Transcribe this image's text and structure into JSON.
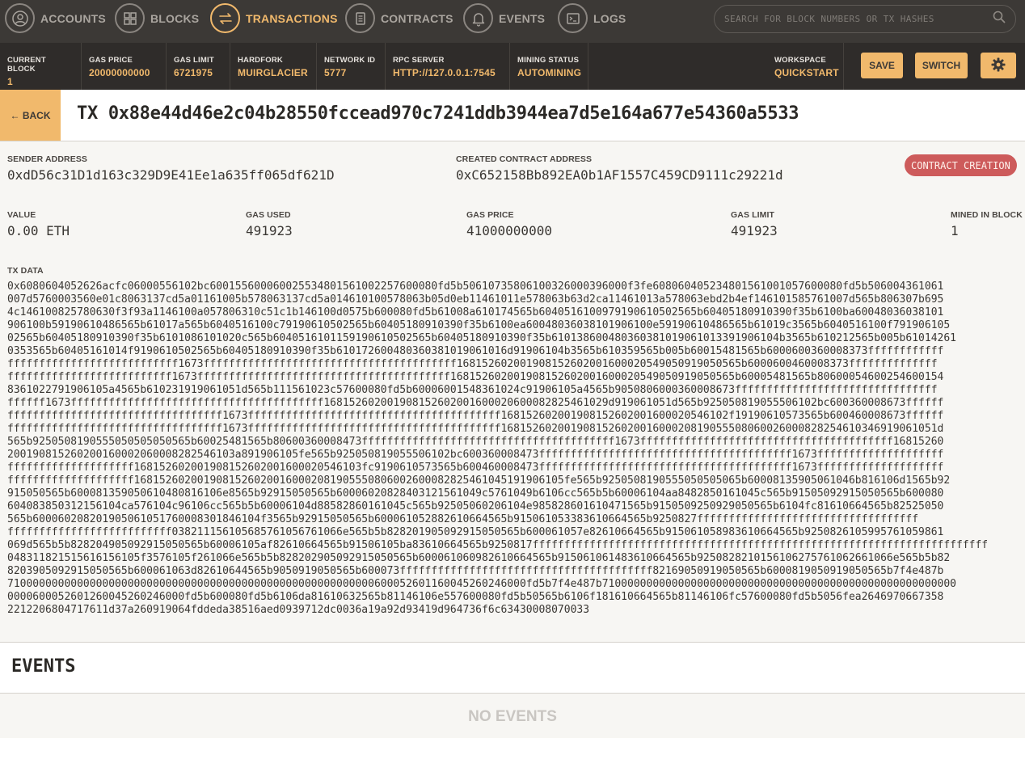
{
  "nav": {
    "items": [
      {
        "label": "Accounts",
        "icon": "person-icon"
      },
      {
        "label": "Blocks",
        "icon": "grid-icon"
      },
      {
        "label": "Transactions",
        "icon": "swap-arrows-icon"
      },
      {
        "label": "Contracts",
        "icon": "document-icon"
      },
      {
        "label": "Events",
        "icon": "bell-icon"
      },
      {
        "label": "Logs",
        "icon": "terminal-icon"
      }
    ],
    "active": "Transactions",
    "search_placeholder": "SEARCH FOR BLOCK NUMBERS OR TX HASHES"
  },
  "status": {
    "current_block": {
      "label": "Current Block",
      "value": "1"
    },
    "gas_price": {
      "label": "Gas Price",
      "value": "20000000000"
    },
    "gas_limit": {
      "label": "Gas Limit",
      "value": "6721975"
    },
    "hardfork": {
      "label": "Hardfork",
      "value": "Muirglacier"
    },
    "network_id": {
      "label": "Network ID",
      "value": "5777"
    },
    "rpc_server": {
      "label": "RPC Server",
      "value": "HTTP://127.0.0.1:7545"
    },
    "mining_status": {
      "label": "Mining Status",
      "value": "Automining"
    },
    "workspace": {
      "label": "Workspace",
      "value": "Quickstart"
    },
    "save_label": "Save",
    "switch_label": "Switch"
  },
  "tx": {
    "back_label": "← Back",
    "title": "TX 0x88e44d46e2c04b28550fccead970c7241ddb3944ea7d5e164a677e54360a5533",
    "sender_label": "Sender Address",
    "sender": "0xdD56c31D1d163c329D9E41Ee1a635ff065df621D",
    "contract_label": "Created Contract Address",
    "contract": "0xC652158Bb892EA0b1AF1557C459CD9111c29221d",
    "badge": "CONTRACT CREATION",
    "value_label": "Value",
    "value": "0.00 ETH",
    "gas_used_label": "Gas Used",
    "gas_used": "491923",
    "gas_price_label": "Gas Price",
    "gas_price": "41000000000",
    "gas_limit_label": "Gas Limit",
    "gas_limit": "491923",
    "mined_label": "Mined In Block",
    "mined": "1",
    "data_label": "TX Data",
    "data_lines": [
      "0x6080604052626acfc06000556102bc600155600060025534801561002257600080fd5b5061073580610032600039600 0f3fe6080604052348015610010576000 80fd5b506004361061",
      "007d5760003560e01c8063137cd5a01161005b578063137cd5a014610100578063b05d0eb11461011e578063b63d2ca11461013a578063ebd2b4ef146101585761007d565b806307b695",
      "4c146100825780630f3f93a1146100a057806310c51c1b146100d0575b600080fd5b61008a610174565b60405161009791906105025 65b60405180910390f35b6100ba60048036038101",
      "906100b59190610486565b61017a565b6040516100c79190610502565b60405180910390f35b6100ea6004803603810190610 0e59190610486565b61019c3565b6040516100f791906105",
      "02565b60405180910390f35b61010861010 20c565b6040516101159190610502565b60405180910390f35b6101386004803603810 19061013391906104b3565b610212565b005b61014261",
      "0353565b60405161014f9190610502565b60405180910390f35b61017260048036038101906101 6d91906104b3565b610359565b005b60015481565b6000600360008373ffffffffffff",
      "fffffffffffffffffffffffffff1673ffffffffffffffffffffffffffffffffffffffff168152602001908152602001600020549050919050565b60006004600083 73ffffffffffffff",
      "ffffffffffffffffffffffffff1673ffffffffffffffffffffffffffffffffffffffff16815260200190815260200160002054905091905056 5b60005481565b806000546002546001 54",
      "8361022791906105a4565b610231919061051d565b111561023c57600080fd5b60006001548361024c919061 05a4565b9050806000360008673ffffffffffffffffffffffffffffffff",
      "ffffff1673ffffffffffffffffffffffffffffffffffffffff16815260200190815260200160002060008282546 1029d919061051d565b925050819055506102bc600360008673ffffff",
      "ffffffffffffffffffffffffffffffffff1673ffffffffffffffffffffffffffffffffffffffff16815260200190815260200160002054 6102f19190610573565b600460008673ffffff",
      "ffffffffffffffffffffffffffffffffff1673ffffffffffffffffffffffffffffffffffffffff168152602001908152602001600020819055508060026000828254 61034691906 1051d",
      "565b92505081905550505050505 65b60025481565b80600360008473ffffffffffffffffffffffffffffffffffffffff1673ffffffffffffffffffffffffffffffffffffffff16815260",
      "2001908152602001600020600082825461 03a891906105fe565b925050819055506102bc600360008473ffffffffffffffffffffffffffffffffffffffff1673ffffffffffffffffffff",
      "ffffffffffffffffffff1681526020019081526020016000205461 03fc9190610573565b600460008473ffffffffffffffffffffffffffffffffffffffff1673ffffffffffffffffffff",
      "ffffffffffffffffffff1681526020019081526020016000208190555080600260008282546104519190610 5fe565b9250508190555050505065b60008135905061046b816106d1565b92",
      "915050565b6000813590506104808161 06e8565b92915050565b6000602082840312156104 9c5761049b6106cc565b5b6000610 4aa848285016104 5c565b91505092915050565b600080",
      "6040838503121561 04ca576104c96106cc565b5b60006104d88582860161045c565b92505060206104e985828601610471565b9150509250929050 565b6104fc81610664565b82525050",
      "565b600060208201905061 0517600083018461 04f3565b92915050565b60006105288261066456 5b9150610533836106645 65b9250827fffffffffffffffffffffffffffffffffff",
      "ffffffffffffffffffffffffff0382111561 0568576105676106 6e565b5b828201905092915050565b60006105 7e82610664565b91506105898361066 4565b9250826105995761059861",
      "069d565b5b828204905092915050565b60006105af82610664565b915061 05ba83610664565b9250817 ffffffffffffffffffffffffffffffffffffffffffffffffffffffffffffffffffffffff",
      "04831182151561 6156105f3576105f261066e565b5b828202905092915050565b60006106098261066456 5b915061 0614836106645 65b9250828210156106 27576106 2661066e565b5b82",
      "820390509291505056 5b60006106 3d82610644565b9050919050565b600073ffffffffffffffffffffffffffffffffffffffff82169050919050565b60008190509190505 65b7f4e487b",
      "71000000000000000000000000000000000000000000000000000000006000526011 600452602460 00fd5b7f4e487b71000000000000000000000000000000000000000000000000000000",
      "000060005260126004526024 6000fd5b600080fd5b6106da81610632565b81146106e557600080fd5b50565b6106f181 610664565b81146106fc57600080fd5b5056fea2646970667358",
      "2212206804717611d37a260919064fddeda38516aed0939712dc0036a19a92d93419d964736f6c63430008070033"
    ]
  },
  "events": {
    "title": "EVENTS",
    "empty": "No Events"
  },
  "colors": {
    "nav_bg": "#3c3936",
    "status_bg": "#2f2c2a",
    "accent": "#f1b96c",
    "badge": "#cd5b5b",
    "panel_bg": "#f7f6f3"
  }
}
